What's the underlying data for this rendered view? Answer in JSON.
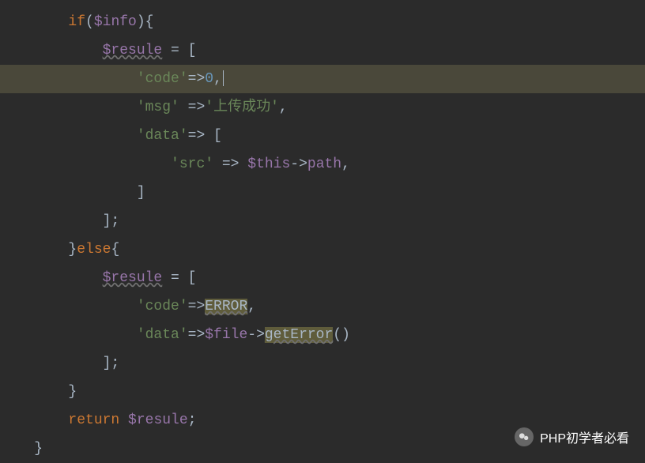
{
  "code": {
    "line1": {
      "indent": "        ",
      "if": "if",
      "paren_open": "(",
      "var": "$info",
      "paren_close": ")",
      "brace": "{"
    },
    "line2": {
      "indent": "            ",
      "var": "$resule",
      "equals": " = ",
      "bracket": "["
    },
    "line3": {
      "indent": "                ",
      "key": "'code'",
      "arrow": "=>",
      "value": "0",
      "comma": ","
    },
    "line4": {
      "indent": "                ",
      "key": "'msg'",
      "space": " ",
      "arrow": "=>",
      "value": "'上传成功'",
      "comma": ","
    },
    "line5": {
      "indent": "                ",
      "key": "'data'",
      "arrow": "=> ",
      "bracket": "["
    },
    "line6": {
      "indent": "                    ",
      "key": "'src'",
      "arrow": " => ",
      "var": "$this",
      "op": "->",
      "prop": "path",
      "comma": ","
    },
    "line7": {
      "indent": "                ",
      "bracket": "]"
    },
    "line8": {
      "indent": "            ",
      "bracket": "];"
    },
    "line9": {
      "indent": "        ",
      "brace": "}",
      "else": "else",
      "brace2": "{"
    },
    "line10": {
      "indent": "            ",
      "var": "$resule",
      "equals": " = ",
      "bracket": "["
    },
    "line11": {
      "indent": "                ",
      "key": "'code'",
      "arrow": "=>",
      "const": "ERROR",
      "comma": ","
    },
    "line12": {
      "indent": "                ",
      "key": "'data'",
      "arrow": "=>",
      "var": "$file",
      "op": "->",
      "method": "getError",
      "parens": "()"
    },
    "line13": {
      "indent": "            ",
      "bracket": "];"
    },
    "line14": {
      "indent": "        ",
      "brace": "}"
    },
    "line15": {
      "indent": "        ",
      "return": "return",
      "space": " ",
      "var": "$resule",
      "semi": ";"
    },
    "line16": {
      "indent": "    ",
      "brace": "}"
    }
  },
  "watermark": {
    "text": "PHP初学者必看"
  }
}
